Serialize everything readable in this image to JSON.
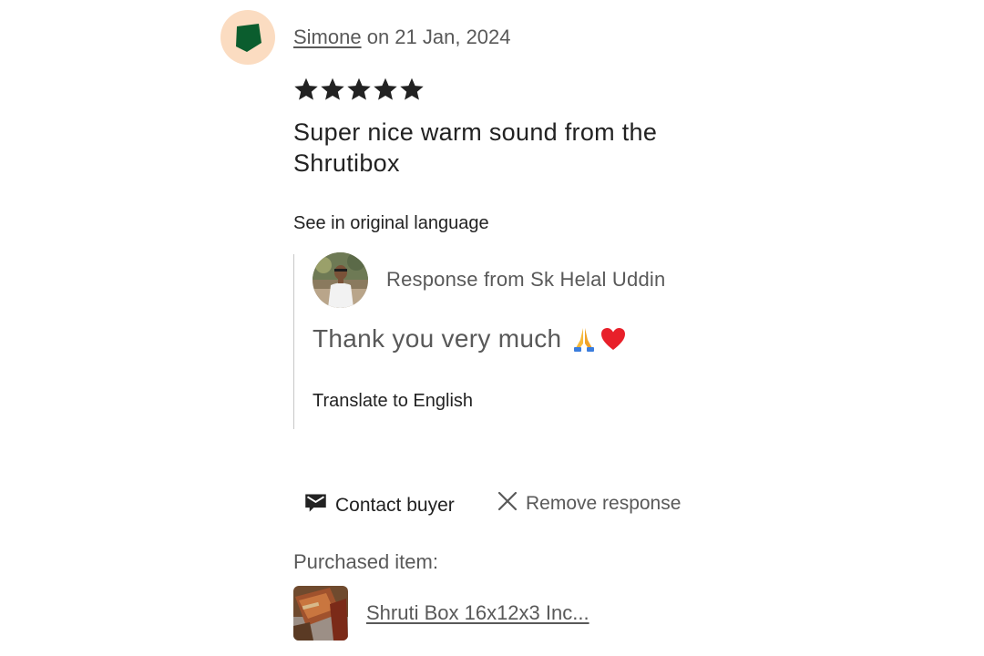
{
  "review": {
    "reviewer_name": "Simone",
    "date_text": " on 21 Jan, 2024",
    "rating": 5,
    "text": "Super nice warm sound from the Shrutibox",
    "see_original_label": "See in original language"
  },
  "response": {
    "from_label": "Response from Sk Helal Uddin",
    "text": "Thank you very much",
    "emojis": [
      "folded-hands-icon",
      "red-heart-icon"
    ],
    "translate_label": "Translate to English"
  },
  "actions": {
    "contact_label": "Contact buyer",
    "remove_label": "Remove response"
  },
  "purchased": {
    "label": "Purchased item:",
    "item_title": "Shruti Box 16x12x3 Inc..."
  },
  "colors": {
    "avatar_bg": "#fbdcc1",
    "avatar_shape": "#0b5d2e",
    "text_primary": "#222222",
    "text_secondary": "#595959",
    "heart": "#e8202a"
  }
}
